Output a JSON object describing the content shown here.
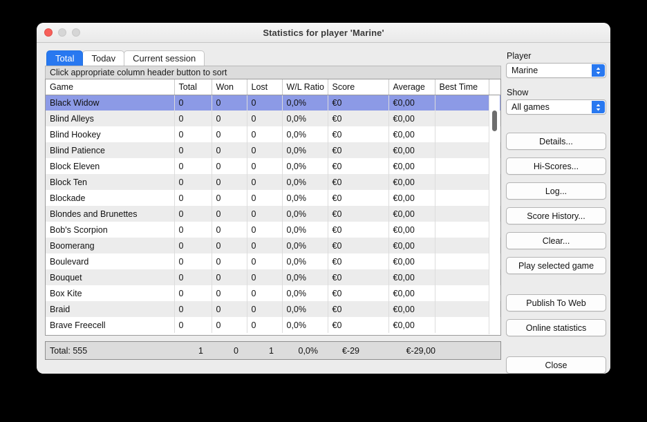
{
  "window": {
    "title": "Statistics for player 'Marine'",
    "controls": {
      "close": "close-button",
      "minimize": "minimize-button",
      "maximize": "maximize-button"
    }
  },
  "tabs": [
    {
      "label": "Total",
      "active": true
    },
    {
      "label": "Todav",
      "active": false
    },
    {
      "label": "Current session",
      "active": false
    }
  ],
  "hint": "Click appropriate column header button to sort",
  "table": {
    "columns": [
      "Game",
      "Total",
      "Won",
      "Lost",
      "W/L Ratio",
      "Score",
      "Average",
      "Best Time"
    ],
    "rows": [
      {
        "game": "Black Widow",
        "total": "0",
        "won": "0",
        "lost": "0",
        "ratio": "0,0%",
        "score": "€0",
        "average": "€0,00",
        "best_time": "",
        "selected": true
      },
      {
        "game": "Blind Alleys",
        "total": "0",
        "won": "0",
        "lost": "0",
        "ratio": "0,0%",
        "score": "€0",
        "average": "€0,00",
        "best_time": "",
        "selected": false
      },
      {
        "game": "Blind Hookey",
        "total": "0",
        "won": "0",
        "lost": "0",
        "ratio": "0,0%",
        "score": "€0",
        "average": "€0,00",
        "best_time": "",
        "selected": false
      },
      {
        "game": "Blind Patience",
        "total": "0",
        "won": "0",
        "lost": "0",
        "ratio": "0,0%",
        "score": "€0",
        "average": "€0,00",
        "best_time": "",
        "selected": false
      },
      {
        "game": "Block Eleven",
        "total": "0",
        "won": "0",
        "lost": "0",
        "ratio": "0,0%",
        "score": "€0",
        "average": "€0,00",
        "best_time": "",
        "selected": false
      },
      {
        "game": "Block Ten",
        "total": "0",
        "won": "0",
        "lost": "0",
        "ratio": "0,0%",
        "score": "€0",
        "average": "€0,00",
        "best_time": "",
        "selected": false
      },
      {
        "game": "Blockade",
        "total": "0",
        "won": "0",
        "lost": "0",
        "ratio": "0,0%",
        "score": "€0",
        "average": "€0,00",
        "best_time": "",
        "selected": false
      },
      {
        "game": "Blondes and Brunettes",
        "total": "0",
        "won": "0",
        "lost": "0",
        "ratio": "0,0%",
        "score": "€0",
        "average": "€0,00",
        "best_time": "",
        "selected": false
      },
      {
        "game": "Bob's Scorpion",
        "total": "0",
        "won": "0",
        "lost": "0",
        "ratio": "0,0%",
        "score": "€0",
        "average": "€0,00",
        "best_time": "",
        "selected": false
      },
      {
        "game": "Boomerang",
        "total": "0",
        "won": "0",
        "lost": "0",
        "ratio": "0,0%",
        "score": "€0",
        "average": "€0,00",
        "best_time": "",
        "selected": false
      },
      {
        "game": "Boulevard",
        "total": "0",
        "won": "0",
        "lost": "0",
        "ratio": "0,0%",
        "score": "€0",
        "average": "€0,00",
        "best_time": "",
        "selected": false
      },
      {
        "game": "Bouquet",
        "total": "0",
        "won": "0",
        "lost": "0",
        "ratio": "0,0%",
        "score": "€0",
        "average": "€0,00",
        "best_time": "",
        "selected": false
      },
      {
        "game": "Box Kite",
        "total": "0",
        "won": "0",
        "lost": "0",
        "ratio": "0,0%",
        "score": "€0",
        "average": "€0,00",
        "best_time": "",
        "selected": false
      },
      {
        "game": "Braid",
        "total": "0",
        "won": "0",
        "lost": "0",
        "ratio": "0,0%",
        "score": "€0",
        "average": "€0,00",
        "best_time": "",
        "selected": false
      },
      {
        "game": "Brave Freecell",
        "total": "0",
        "won": "0",
        "lost": "0",
        "ratio": "0,0%",
        "score": "€0",
        "average": "€0,00",
        "best_time": "",
        "selected": false
      }
    ]
  },
  "totals": {
    "label": "Total: 555",
    "total": "1",
    "won": "0",
    "lost": "1",
    "ratio": "0,0%",
    "score": "€-29",
    "average": "€-29,00"
  },
  "sidebar": {
    "player_label": "Player",
    "player_value": "Marine",
    "show_label": "Show",
    "show_value": "All games",
    "buttons": [
      {
        "label": "Details..."
      },
      {
        "label": "Hi-Scores..."
      },
      {
        "label": "Log..."
      },
      {
        "label": "Score History..."
      },
      {
        "label": "Clear..."
      },
      {
        "label": "Play selected game"
      },
      {
        "label": "Publish To Web"
      },
      {
        "label": "Online statistics"
      },
      {
        "label": "Close"
      }
    ]
  },
  "colors": {
    "accent": "#2878f0",
    "selection": "#8c9ae6",
    "window_bg": "#ececec",
    "desktop_bg": "#000000",
    "close_light": "#f7605a"
  }
}
